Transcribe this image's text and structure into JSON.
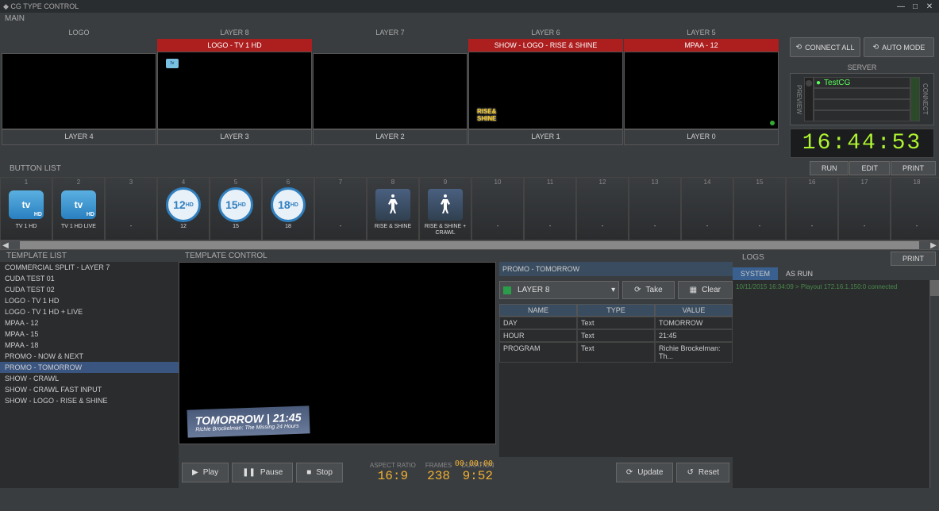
{
  "window_title": "CG TYPE CONTROL",
  "main_label": "MAIN",
  "layers_top": [
    {
      "header": "LOGO",
      "title": "",
      "content": ""
    },
    {
      "header": "LAYER 8",
      "title": "LOGO - TV 1 HD",
      "content": "logo"
    },
    {
      "header": "LAYER 7",
      "title": "",
      "content": ""
    },
    {
      "header": "LAYER 6",
      "title": "SHOW - LOGO - RISE & SHINE",
      "content": "rise"
    },
    {
      "header": "LAYER 5",
      "title": "MPAA - 12",
      "content": "dot"
    }
  ],
  "layers_bottom": [
    "LAYER 4",
    "LAYER 3",
    "LAYER 2",
    "LAYER 1",
    "LAYER 0"
  ],
  "top_buttons": {
    "connect_all": "CONNECT ALL",
    "auto_mode": "AUTO MODE"
  },
  "server_label": "SERVER",
  "preview_label": "PREVIEW",
  "connect_label": "CONNECT",
  "servers": [
    "TestCG",
    "",
    "",
    ""
  ],
  "clock": "16:44:53",
  "button_list_label": "BUTTON LIST",
  "button_list_actions": {
    "run": "RUN",
    "edit": "EDIT",
    "print": "PRINT"
  },
  "buttons": [
    {
      "num": "1",
      "label": "TV 1 HD",
      "type": "tv"
    },
    {
      "num": "2",
      "label": "TV 1 HD LIVE",
      "type": "tv"
    },
    {
      "num": "3",
      "label": "-",
      "type": "empty"
    },
    {
      "num": "4",
      "label": "12",
      "type": "age",
      "val": "12"
    },
    {
      "num": "5",
      "label": "15",
      "type": "age",
      "val": "15"
    },
    {
      "num": "6",
      "label": "18",
      "type": "age",
      "val": "18"
    },
    {
      "num": "7",
      "label": "-",
      "type": "empty"
    },
    {
      "num": "8",
      "label": "RISE & SHINE",
      "type": "dance"
    },
    {
      "num": "9",
      "label": "RISE & SHINE + CRAWL",
      "type": "dance"
    },
    {
      "num": "10",
      "label": "-",
      "type": "empty"
    },
    {
      "num": "11",
      "label": "-",
      "type": "empty"
    },
    {
      "num": "12",
      "label": "-",
      "type": "empty"
    },
    {
      "num": "13",
      "label": "-",
      "type": "empty"
    },
    {
      "num": "14",
      "label": "-",
      "type": "empty"
    },
    {
      "num": "15",
      "label": "-",
      "type": "empty"
    },
    {
      "num": "16",
      "label": "-",
      "type": "empty"
    },
    {
      "num": "17",
      "label": "-",
      "type": "empty"
    },
    {
      "num": "18",
      "label": "-",
      "type": "empty"
    }
  ],
  "template_list_label": "TEMPLATE LIST",
  "templates": [
    "COMMERCIAL SPLIT - LAYER 7",
    "CUDA TEST 01",
    "CUDA TEST 02",
    "LOGO - TV 1 HD",
    "LOGO - TV 1 HD + LIVE",
    "MPAA - 12",
    "MPAA - 15",
    "MPAA - 18",
    "PROMO - NOW & NEXT",
    "PROMO - TOMORROW",
    "SHOW - CRAWL",
    "SHOW - CRAWL FAST INPUT",
    "SHOW - LOGO - RISE & SHINE"
  ],
  "selected_template_index": 9,
  "template_control_label": "TEMPLATE CONTROL",
  "promo": {
    "title": "TOMORROW",
    "time": "21:45",
    "sub": "Richie Brockelman: The Missing 24 Hours"
  },
  "preview_timecode": "00:00:00",
  "param_title": "PROMO - TOMORROW",
  "layer_selector": "LAYER 8",
  "take_btn": "Take",
  "clear_btn": "Clear",
  "param_headers": {
    "name": "NAME",
    "type": "TYPE",
    "value": "VALUE"
  },
  "params": [
    {
      "name": "DAY",
      "type": "Text",
      "value": "TOMORROW"
    },
    {
      "name": "HOUR",
      "type": "Text",
      "value": "21:45"
    },
    {
      "name": "PROGRAM",
      "type": "Text",
      "value": "Richie Brockelman: Th..."
    }
  ],
  "playback": {
    "play": "Play",
    "pause": "Pause",
    "stop": "Stop",
    "update": "Update",
    "reset": "Reset"
  },
  "readouts": {
    "aspect_label": "ASPECT RATIO",
    "aspect_value": "16:9",
    "frames_label": "FRAMES",
    "frames_value": "238",
    "duration_label": "DURATION",
    "duration_value": "9:52"
  },
  "logs_label": "LOGS",
  "logs_print": "PRINT",
  "log_tabs": {
    "system": "SYSTEM",
    "asrun": "AS RUN"
  },
  "log_entry": "10/11/2015 16:34:09 > Playout 172.16.1.150:0 connected"
}
